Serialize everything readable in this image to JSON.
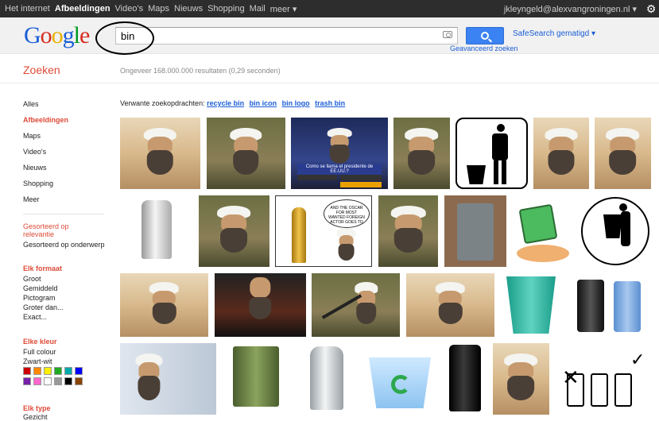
{
  "topnav": {
    "items": [
      "Het internet",
      "Afbeeldingen",
      "Video's",
      "Maps",
      "Nieuws",
      "Shopping",
      "Mail",
      "meer ▾"
    ],
    "active_index": 1,
    "account": "jkleyngeld@alexvangroningen.nl ▾",
    "gear_icon": "gear-icon"
  },
  "header": {
    "logo_text": "Google",
    "query": "bin",
    "search_button_icon": "search-icon",
    "camera_icon": "camera-icon",
    "safesearch": "SafeSearch gematigd ▾",
    "advanced": "Geavanceerd zoeken"
  },
  "title": {
    "heading": "Zoeken",
    "results_text": "Ongeveer 168.000.000 resultaten (0,29 seconden)"
  },
  "sidebar": {
    "nav": [
      "Alles",
      "Afbeeldingen",
      "Maps",
      "Video's",
      "Nieuws",
      "Shopping",
      "Meer"
    ],
    "active_nav": 1,
    "sort_heading": "Gesorteerd op relevantie",
    "sort_option": "Gesorteerd op onderwerp",
    "format_heading": "Elk formaat",
    "format_options": [
      "Groot",
      "Gemiddeld",
      "Pictogram",
      "Groter dan...",
      "Exact..."
    ],
    "color_heading": "Elke kleur",
    "color_options": [
      "Full colour",
      "Zwart-wit"
    ],
    "swatches": [
      "#cc0000",
      "#ff8800",
      "#ffee00",
      "#22aa22",
      "#00aaaa",
      "#0000ff",
      "#7722aa",
      "#ff66cc",
      "#ffffff",
      "#999999",
      "#000000",
      "#884400"
    ],
    "type_heading": "Elk type",
    "type_options": [
      "Gezicht"
    ]
  },
  "related": {
    "prefix": "Verwante zoekopdrachten:",
    "links": [
      "recycle bin",
      "bin icon",
      "bin logo",
      "trash bin"
    ]
  },
  "images": {
    "row1": [
      "portrait",
      "portrait-wave",
      "quiz-show",
      "portrait-camo",
      "trash-pictogram",
      "portrait",
      "portrait"
    ],
    "row2": [
      "pedal-bin",
      "portrait-wave",
      "oscar-cartoon",
      "portrait-wave",
      "wheelie-bin-grey",
      "recycle-mascot",
      "trash-pictogram-round"
    ],
    "row3": [
      "portrait",
      "portrait-dark",
      "portrait-rifle",
      "portrait",
      "recycle-basket-green",
      "double-bins"
    ],
    "row4": [
      "portrait-fbi",
      "wheelie-bin-green",
      "swing-bin-silver",
      "recycle-bin-icon",
      "round-bin-black",
      "portrait",
      "sorting-bins-cartoon"
    ],
    "quiz_caption": "Como se llama el presidente de EE.UU.?",
    "oscar_caption": "AND THE OSCAR FOR MOST WANTED FOREIGN ACTOR GOES TO"
  }
}
